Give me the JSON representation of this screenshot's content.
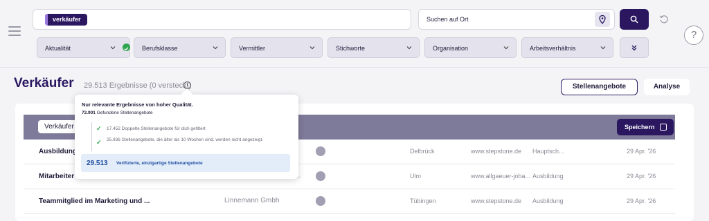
{
  "search": {
    "chip": "verkäufer"
  },
  "location": {
    "placeholder": "Suchen auf Ort"
  },
  "filters": [
    "Aktualität",
    "Berufsklasse",
    "Vermittler",
    "Stichworte",
    "Organisation",
    "Arbeitsverhältnis"
  ],
  "results": {
    "title": "Verkäufer",
    "count": "29.513 Ergebnisse (0 versteckt)",
    "offers_label": "Stellenangebote",
    "analysis_label": "Analyse"
  },
  "table_bar": {
    "search_value": "Verkäufer",
    "save_label": "Speichern"
  },
  "rows": [
    {
      "title": "Ausbildung",
      "company": "",
      "city": "Delbrück",
      "source": "www.stepstone.de",
      "category": "Hauptsch...",
      "date": "29 Apr. '26"
    },
    {
      "title": "Mitarbeiter",
      "company": "...",
      "city": "Ulm",
      "source": "www.allgaeuer-joba...",
      "category": "Ausbildung",
      "date": "29 Apr. '26"
    },
    {
      "title": "Teammitglied im Marketing und ...",
      "company": "Linnemann Gmbh",
      "city": "Tübingen",
      "source": "www.stepstone.de",
      "category": "Ausbildung",
      "date": "29 Apr. '26"
    }
  ],
  "tooltip": {
    "heading": "Nur relevante Ergebnisse von hoher Qualität.",
    "found_num": "72.901",
    "found_label": "Gefundene Stellenangebote",
    "dup": "17.452 Doppelte Stellenangebote für dich gefiltert",
    "old": "25.936 Stellenangebote, die älter als 10 Wochen sind, werden nicht angezeigt.",
    "verified_num": "29.513",
    "verified_label": "Verifizierte, einzigartige Stellenangebote"
  },
  "colors": {
    "brand": "#2a1760",
    "success": "#2ea44f",
    "link": "#1e4fa1"
  }
}
